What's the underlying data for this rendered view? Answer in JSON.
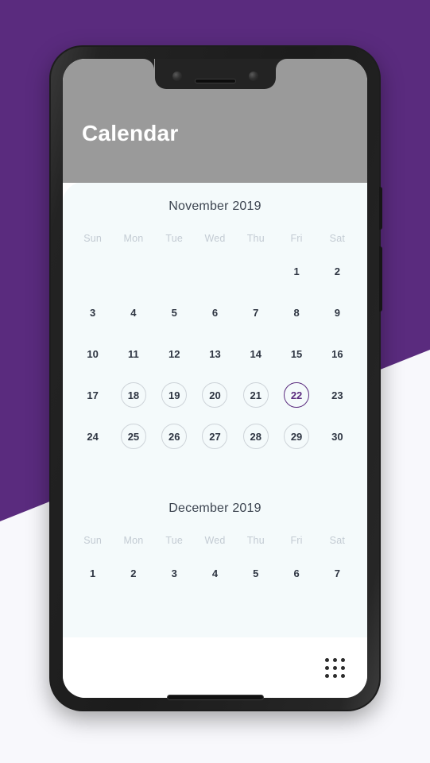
{
  "theme": {
    "background_purple": "#5a2b7e",
    "page_background": "#f8f8fc",
    "appbar_gray": "#9a9a9a",
    "sheet_background": "#f4fafb",
    "accent": "#5a2b7e",
    "circle_outline": "#cdd3d8",
    "date_text": "#2e3542",
    "weekday_text": "#c3cbd3"
  },
  "appbar": {
    "title": "Calendar"
  },
  "weekdays": [
    "Sun",
    "Mon",
    "Tue",
    "Wed",
    "Thu",
    "Fri",
    "Sat"
  ],
  "months": [
    {
      "title": "November 2019",
      "weeks": [
        [
          {
            "day": "",
            "circled": false,
            "selected": false
          },
          {
            "day": "",
            "circled": false,
            "selected": false
          },
          {
            "day": "",
            "circled": false,
            "selected": false
          },
          {
            "day": "",
            "circled": false,
            "selected": false
          },
          {
            "day": "",
            "circled": false,
            "selected": false
          },
          {
            "day": "1",
            "circled": false,
            "selected": false
          },
          {
            "day": "2",
            "circled": false,
            "selected": false
          }
        ],
        [
          {
            "day": "3",
            "circled": false,
            "selected": false
          },
          {
            "day": "4",
            "circled": false,
            "selected": false
          },
          {
            "day": "5",
            "circled": false,
            "selected": false
          },
          {
            "day": "6",
            "circled": false,
            "selected": false
          },
          {
            "day": "7",
            "circled": false,
            "selected": false
          },
          {
            "day": "8",
            "circled": false,
            "selected": false
          },
          {
            "day": "9",
            "circled": false,
            "selected": false
          }
        ],
        [
          {
            "day": "10",
            "circled": false,
            "selected": false
          },
          {
            "day": "11",
            "circled": false,
            "selected": false
          },
          {
            "day": "12",
            "circled": false,
            "selected": false
          },
          {
            "day": "13",
            "circled": false,
            "selected": false
          },
          {
            "day": "14",
            "circled": false,
            "selected": false
          },
          {
            "day": "15",
            "circled": false,
            "selected": false
          },
          {
            "day": "16",
            "circled": false,
            "selected": false
          }
        ],
        [
          {
            "day": "17",
            "circled": false,
            "selected": false
          },
          {
            "day": "18",
            "circled": true,
            "selected": false
          },
          {
            "day": "19",
            "circled": true,
            "selected": false
          },
          {
            "day": "20",
            "circled": true,
            "selected": false
          },
          {
            "day": "21",
            "circled": true,
            "selected": false
          },
          {
            "day": "22",
            "circled": true,
            "selected": true
          },
          {
            "day": "23",
            "circled": false,
            "selected": false
          }
        ],
        [
          {
            "day": "24",
            "circled": false,
            "selected": false
          },
          {
            "day": "25",
            "circled": true,
            "selected": false
          },
          {
            "day": "26",
            "circled": true,
            "selected": false
          },
          {
            "day": "27",
            "circled": true,
            "selected": false
          },
          {
            "day": "28",
            "circled": true,
            "selected": false
          },
          {
            "day": "29",
            "circled": true,
            "selected": false
          },
          {
            "day": "30",
            "circled": false,
            "selected": false
          }
        ]
      ]
    },
    {
      "title": "December 2019",
      "weeks": [
        [
          {
            "day": "1",
            "circled": false,
            "selected": false
          },
          {
            "day": "2",
            "circled": false,
            "selected": false
          },
          {
            "day": "3",
            "circled": false,
            "selected": false
          },
          {
            "day": "4",
            "circled": false,
            "selected": false
          },
          {
            "day": "5",
            "circled": false,
            "selected": false
          },
          {
            "day": "6",
            "circled": false,
            "selected": false
          },
          {
            "day": "7",
            "circled": false,
            "selected": false
          }
        ]
      ]
    }
  ],
  "bottom_bar": {
    "grid_icon": "grid-dots-icon"
  }
}
